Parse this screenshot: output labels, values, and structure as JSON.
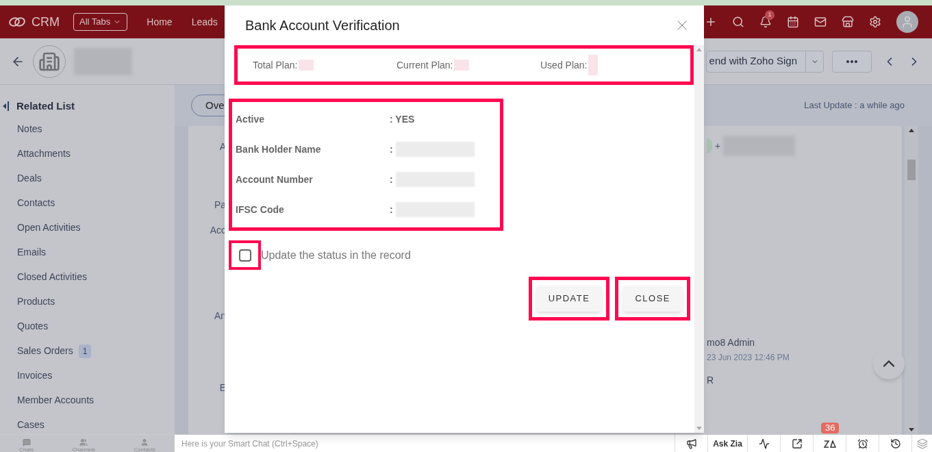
{
  "top_bar": {
    "brand": "CRM",
    "all_tabs": "All Tabs",
    "nav": [
      "Home",
      "Leads"
    ],
    "notification_count": "1"
  },
  "record_header": {
    "sign_button": "end with Zoho Sign"
  },
  "sidebar": {
    "title": "Related List",
    "items": [
      {
        "label": "Notes"
      },
      {
        "label": "Attachments"
      },
      {
        "label": "Deals"
      },
      {
        "label": "Contacts"
      },
      {
        "label": "Open Activities"
      },
      {
        "label": "Emails"
      },
      {
        "label": "Closed Activities"
      },
      {
        "label": "Products"
      },
      {
        "label": "Quotes"
      },
      {
        "label": "Sales Orders",
        "count": "1"
      },
      {
        "label": "Invoices"
      },
      {
        "label": "Member Accounts"
      },
      {
        "label": "Cases"
      }
    ]
  },
  "content": {
    "tab": "Ove",
    "last_update": "Last Update : a while ago",
    "field_labels": [
      "A",
      "Pa",
      "Acc",
      "An",
      "E"
    ],
    "phone_prefix": "+",
    "owner": "mo8 Admin",
    "timestamp": "23 Jun 2023 12:46 PM",
    "trailing": "R"
  },
  "modal": {
    "title": "Bank Account Verification",
    "plan": [
      {
        "label": "Total Plan:"
      },
      {
        "label": "Current Plan:"
      },
      {
        "label": "Used Plan:"
      }
    ],
    "details": [
      {
        "label": "Active",
        "value": ": YES",
        "redacted": false
      },
      {
        "label": "Bank Holder Name",
        "value": ":",
        "redacted": true
      },
      {
        "label": "Account Number",
        "value": ":",
        "redacted": true
      },
      {
        "label": "IFSC Code",
        "value": ":",
        "redacted": true
      }
    ],
    "checkbox": {
      "label": "Update the status in the record",
      "checked": false
    },
    "buttons": [
      "UPDATE",
      "CLOSE"
    ]
  },
  "bottom_bar": {
    "tabs": [
      "Chats",
      "Channels",
      "Contacts"
    ],
    "chat_placeholder": "Here is your Smart Chat (Ctrl+Space)",
    "ask_zia": "Ask Zia",
    "zia_count": "36"
  }
}
